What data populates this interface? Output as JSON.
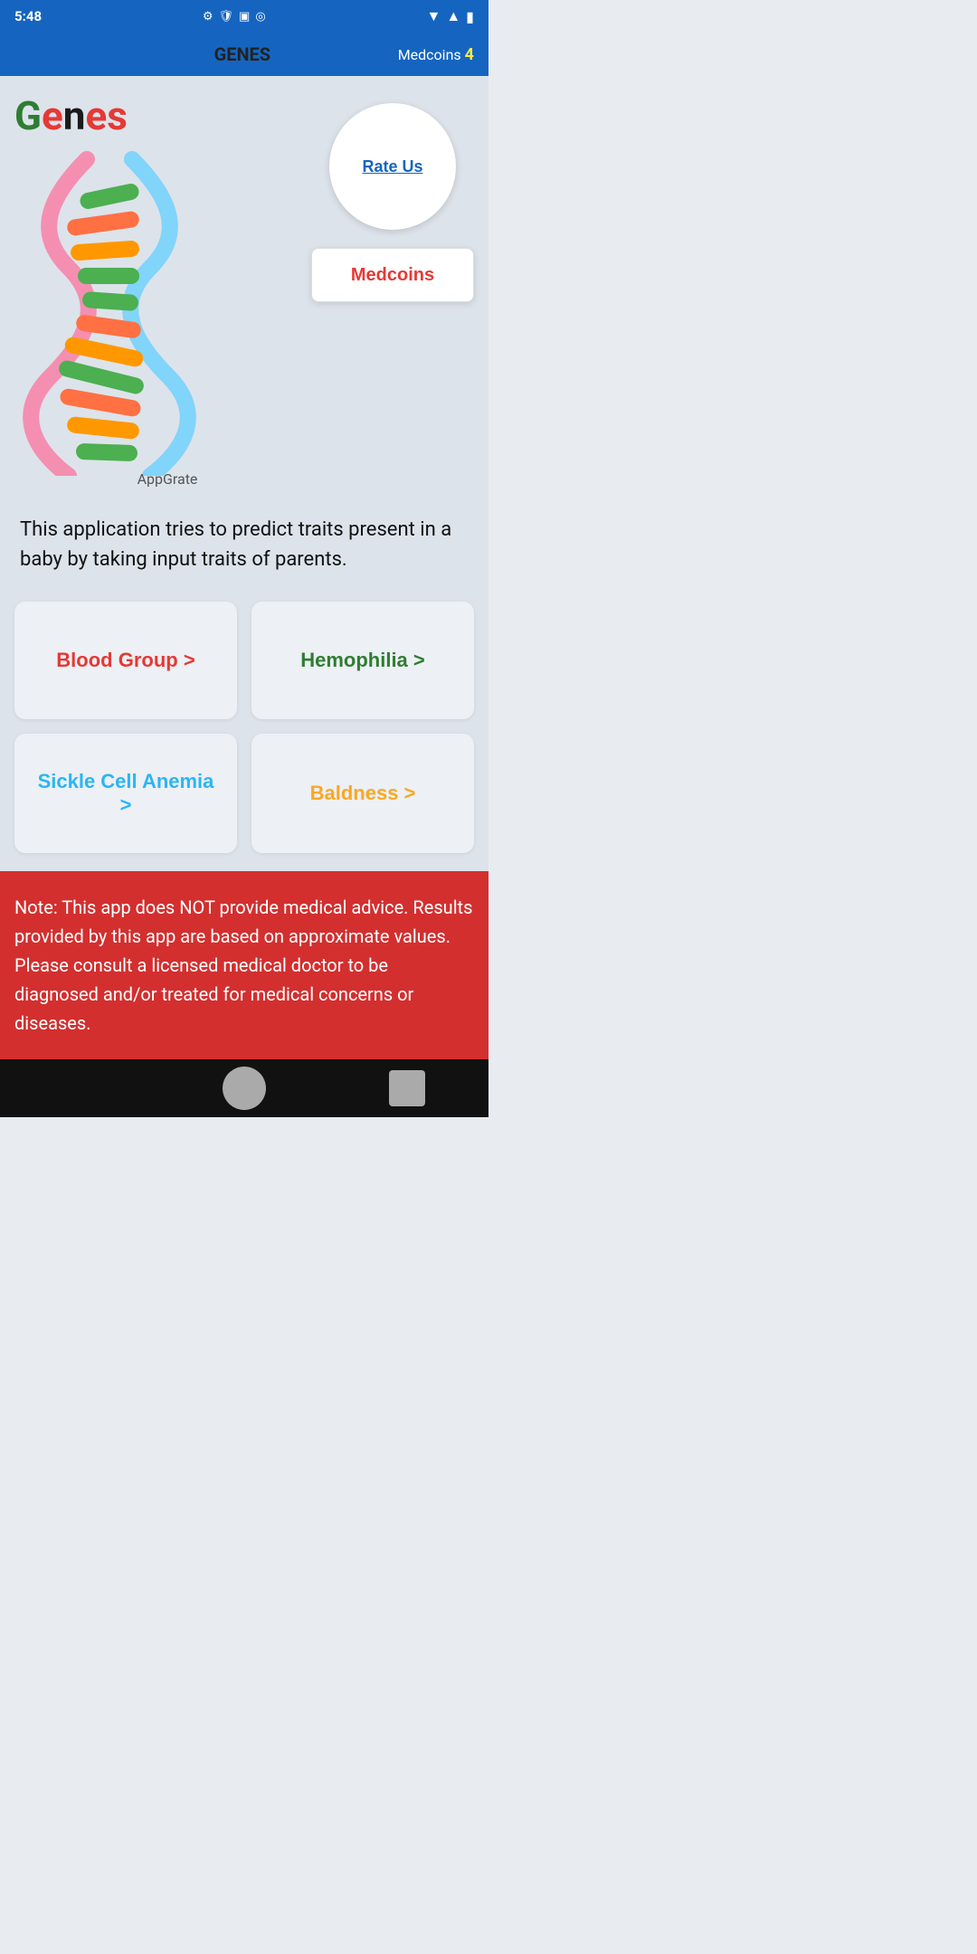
{
  "statusBar": {
    "time": "5:48"
  },
  "appBar": {
    "title": "GENES",
    "medcoinsLabel": "Medcoins",
    "medcoinsCount": "4"
  },
  "logo": {
    "appName": "Genes",
    "brandLabel": "AppGrate"
  },
  "buttons": {
    "rateUs": "Rate Us",
    "medcoins": "Medcoins"
  },
  "description": "This application tries to predict traits present in a baby by taking input traits of parents.",
  "cards": [
    {
      "label": "Blood Group >",
      "colorClass": "card-blood"
    },
    {
      "label": "Hemophilia >",
      "colorClass": "card-hemo"
    },
    {
      "label": "Sickle Cell Anemia >",
      "colorClass": "card-sickle"
    },
    {
      "label": "Baldness >",
      "colorClass": "card-baldness"
    }
  ],
  "note": "Note: This app does NOT provide medical advice. Results provided by this app are based on approximate values. Please consult a licensed medical doctor to be diagnosed and/or treated for medical concerns or diseases."
}
